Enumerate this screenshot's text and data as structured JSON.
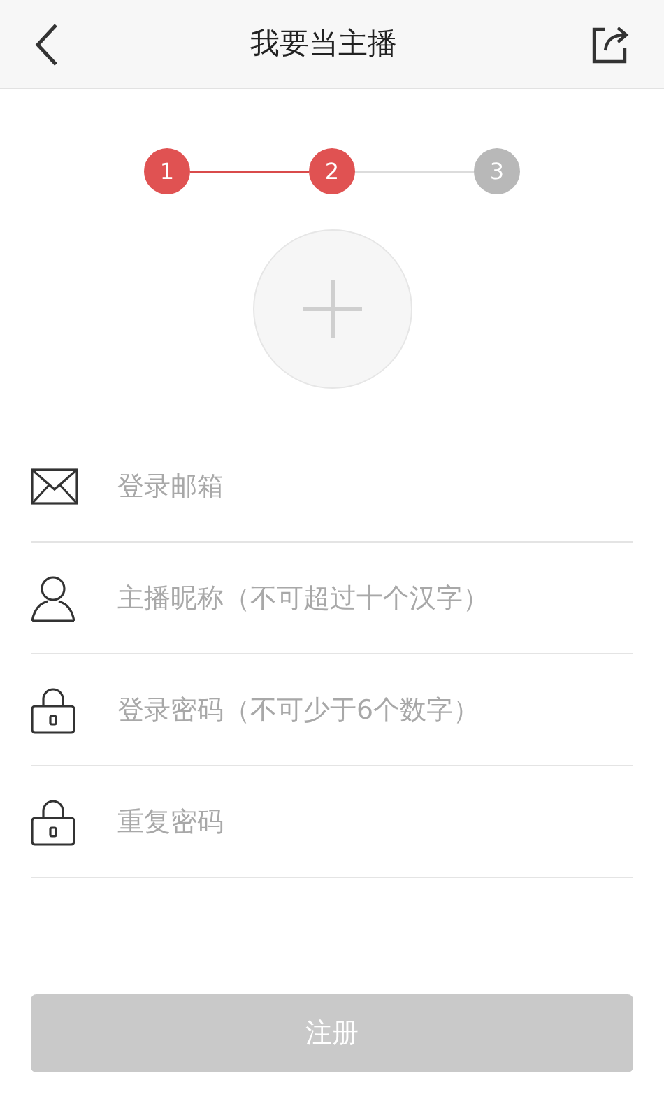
{
  "header": {
    "title": "我要当主播"
  },
  "steps": [
    {
      "label": "1",
      "active": true
    },
    {
      "label": "2",
      "active": true
    },
    {
      "label": "3",
      "active": false
    }
  ],
  "fields": [
    {
      "kind": "mail",
      "placeholder": "登录邮箱"
    },
    {
      "kind": "user",
      "placeholder": "主播昵称（不可超过十个汉字）"
    },
    {
      "kind": "lock",
      "placeholder": "登录密码（不可少于6个数字）"
    },
    {
      "kind": "lock",
      "placeholder": "重复密码"
    }
  ],
  "submit": {
    "label": "注册",
    "disabled": true
  }
}
